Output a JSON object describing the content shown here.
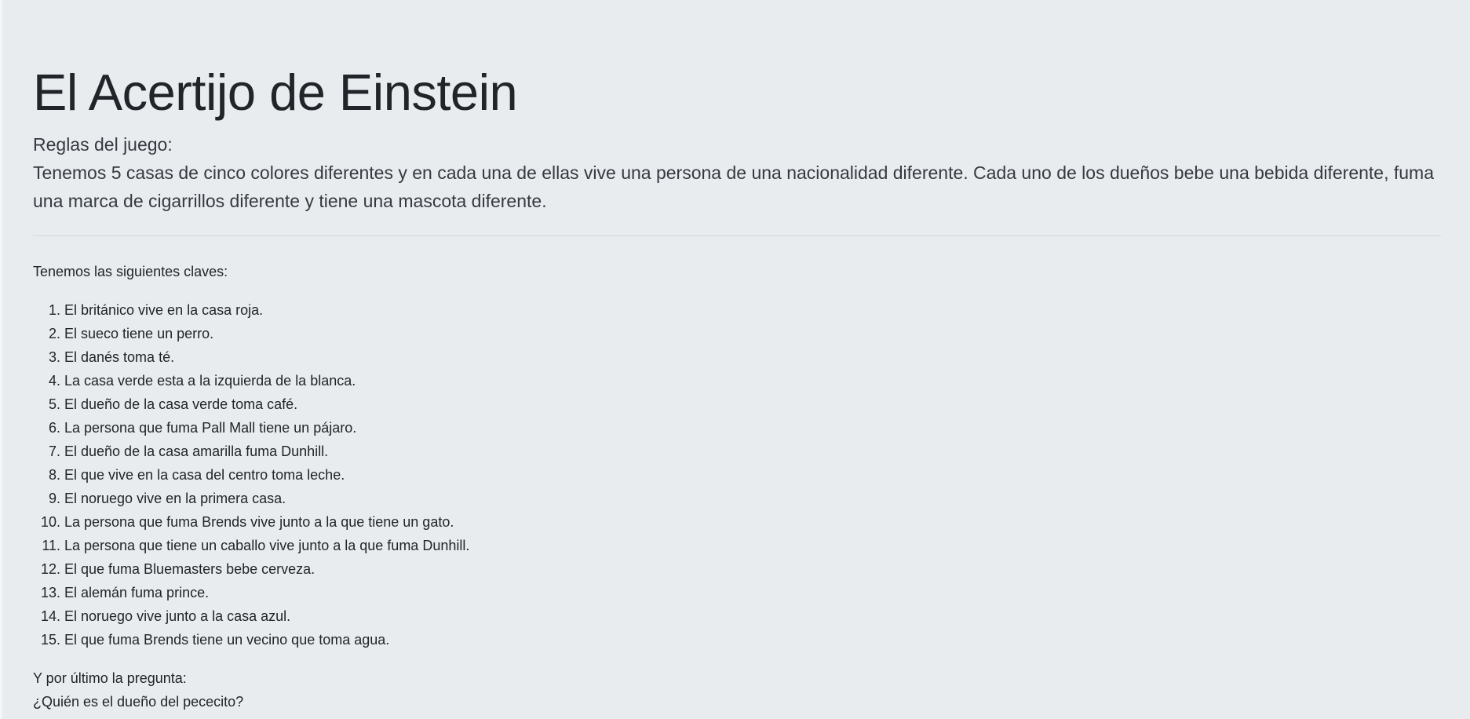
{
  "title": "El Acertijo de Einstein",
  "rules_heading": "Reglas del juego:",
  "rules_text": "Tenemos 5 casas de cinco colores diferentes y en cada una de ellas vive una persona de una nacionalidad diferente. Cada uno de los dueños bebe una bebida diferente, fuma una marca de cigarrillos diferente y tiene una mascota diferente.",
  "clues_intro": "Tenemos las siguientes claves:",
  "clues": [
    "El británico vive en la casa roja.",
    "El sueco tiene un perro.",
    "El danés toma té.",
    "La casa verde esta a la izquierda de la blanca.",
    "El dueño de la casa verde toma café.",
    "La persona que fuma Pall Mall tiene un pájaro.",
    "El dueño de la casa amarilla fuma Dunhill.",
    "El que vive en la casa del centro toma leche.",
    "El noruego vive en la primera casa.",
    "La persona que fuma Brends vive junto a la que tiene un gato.",
    "La persona que tiene un caballo vive junto a la que fuma Dunhill.",
    "El que fuma Bluemasters bebe cerveza.",
    "El alemán fuma prince.",
    "El noruego vive junto a la casa azul.",
    "El que fuma Brends tiene un vecino que toma agua."
  ],
  "question_intro": "Y por último la pregunta:",
  "question": "¿Quién es el dueño del pececito?"
}
